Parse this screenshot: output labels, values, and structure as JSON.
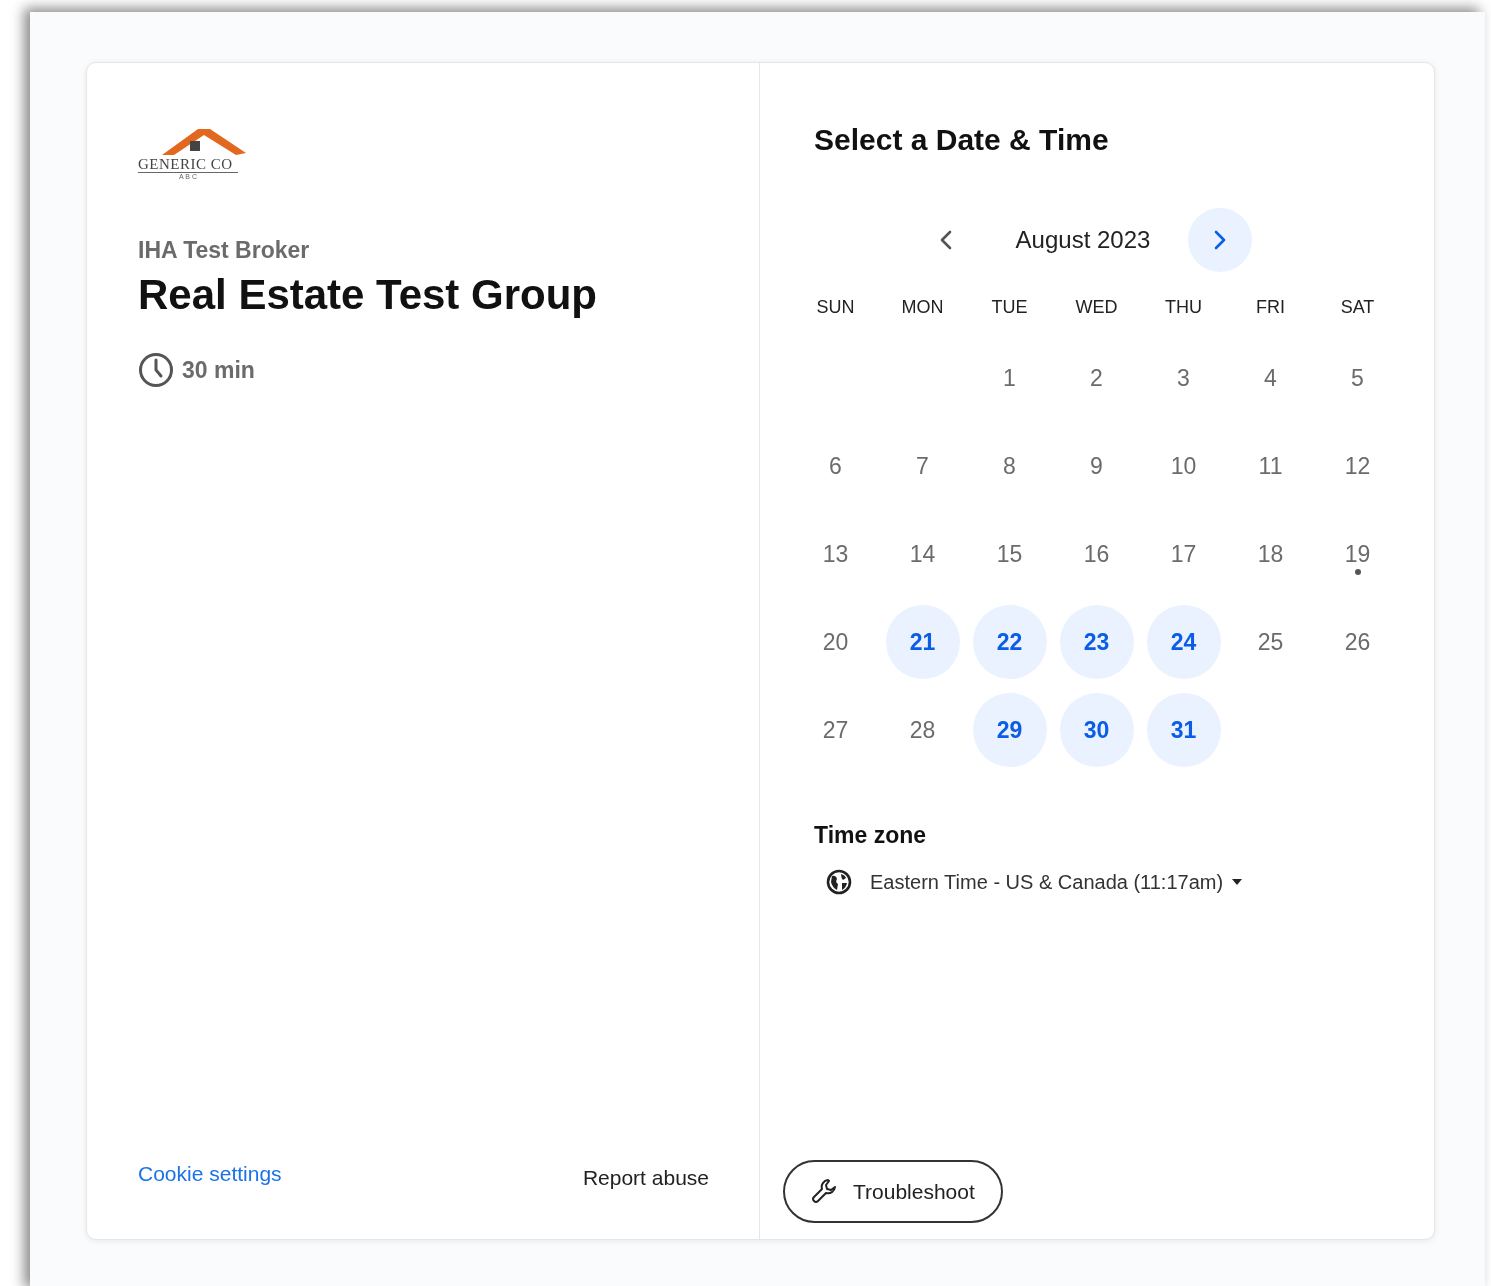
{
  "logo": {
    "name": "GENERIC CO",
    "tagline": "A B C"
  },
  "organizer": "IHA Test Broker",
  "event_title": "Real Estate Test Group",
  "duration": "30 min",
  "heading": "Select a Date & Time",
  "month": "August 2023",
  "nav": [
    {
      "kind": "prev",
      "disabled": true
    },
    {
      "kind": "next",
      "disabled": false
    }
  ],
  "weekdays": [
    "SUN",
    "MON",
    "TUE",
    "WED",
    "THU",
    "FRI",
    "SAT"
  ],
  "weeks": [
    [
      {
        "kind": "blank"
      },
      {
        "kind": "blank"
      },
      {
        "kind": "day",
        "label": "1",
        "available": false,
        "today": false
      },
      {
        "kind": "day",
        "label": "2",
        "available": false,
        "today": false
      },
      {
        "kind": "day",
        "label": "3",
        "available": false,
        "today": false
      },
      {
        "kind": "day",
        "label": "4",
        "available": false,
        "today": false
      },
      {
        "kind": "day",
        "label": "5",
        "available": false,
        "today": false
      }
    ],
    [
      {
        "kind": "day",
        "label": "6",
        "available": false,
        "today": false
      },
      {
        "kind": "day",
        "label": "7",
        "available": false,
        "today": false
      },
      {
        "kind": "day",
        "label": "8",
        "available": false,
        "today": false
      },
      {
        "kind": "day",
        "label": "9",
        "available": false,
        "today": false
      },
      {
        "kind": "day",
        "label": "10",
        "available": false,
        "today": false
      },
      {
        "kind": "day",
        "label": "11",
        "available": false,
        "today": false
      },
      {
        "kind": "day",
        "label": "12",
        "available": false,
        "today": false
      }
    ],
    [
      {
        "kind": "day",
        "label": "13",
        "available": false,
        "today": false
      },
      {
        "kind": "day",
        "label": "14",
        "available": false,
        "today": false
      },
      {
        "kind": "day",
        "label": "15",
        "available": false,
        "today": false
      },
      {
        "kind": "day",
        "label": "16",
        "available": false,
        "today": false
      },
      {
        "kind": "day",
        "label": "17",
        "available": false,
        "today": false
      },
      {
        "kind": "day",
        "label": "18",
        "available": false,
        "today": false
      },
      {
        "kind": "day",
        "label": "19",
        "available": false,
        "today": true
      }
    ],
    [
      {
        "kind": "day",
        "label": "20",
        "available": false,
        "today": false
      },
      {
        "kind": "day",
        "label": "21",
        "available": true,
        "today": false
      },
      {
        "kind": "day",
        "label": "22",
        "available": true,
        "today": false
      },
      {
        "kind": "day",
        "label": "23",
        "available": true,
        "today": false
      },
      {
        "kind": "day",
        "label": "24",
        "available": true,
        "today": false
      },
      {
        "kind": "day",
        "label": "25",
        "available": false,
        "today": false
      },
      {
        "kind": "day",
        "label": "26",
        "available": false,
        "today": false
      }
    ],
    [
      {
        "kind": "day",
        "label": "27",
        "available": false,
        "today": false
      },
      {
        "kind": "day",
        "label": "28",
        "available": false,
        "today": false
      },
      {
        "kind": "day",
        "label": "29",
        "available": true,
        "today": false
      },
      {
        "kind": "day",
        "label": "30",
        "available": true,
        "today": false
      },
      {
        "kind": "day",
        "label": "31",
        "available": true,
        "today": false
      }
    ]
  ],
  "timezone": {
    "label": "Time zone",
    "value": "Eastern Time - US & Canada (11:17am)"
  },
  "footer": {
    "cookie_link": "Cookie settings",
    "report_link": "Report abuse",
    "troubleshoot_button": "Troubleshoot"
  }
}
